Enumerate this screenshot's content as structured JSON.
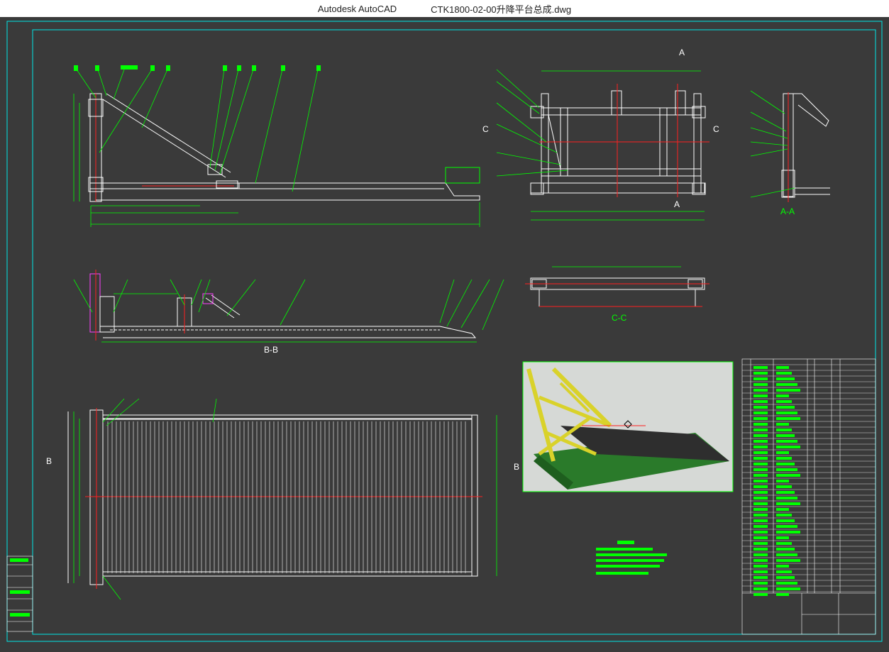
{
  "window": {
    "app_name": "Autodesk AutoCAD",
    "file_name": "CTK1800-02-00升降平台总成.dwg"
  },
  "colors": {
    "background": "#3a3a3a",
    "geometry": "#ffffff",
    "leaders": "#00ff00",
    "dimensions": "#00ff00",
    "centerlines": "#ff2020",
    "border": "#00e5e5"
  },
  "section_labels": {
    "b_b": "B-B",
    "c_c": "C-C",
    "a_a": "A-A",
    "a_marker": "A",
    "b_marker": "B",
    "c_marker": "C"
  },
  "balloons_top": [
    "1",
    "2",
    "3",
    "4",
    "5",
    "6",
    "7",
    "8",
    "9",
    "10"
  ],
  "preview": {
    "description_icon": "3d-model-render"
  }
}
